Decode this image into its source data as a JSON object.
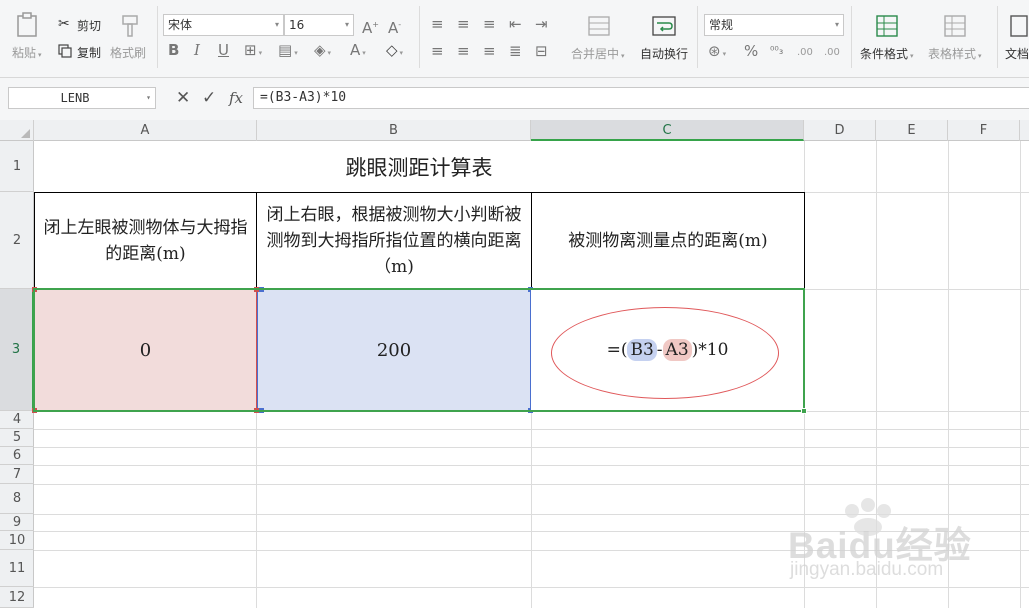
{
  "ribbon": {
    "paste_label": "粘贴",
    "cut_label": "剪切",
    "copy_label": "复制",
    "format_painter_label": "格式刷",
    "font_name": "宋体",
    "font_size": "16",
    "merge_center_label": "合并居中",
    "wrap_text_label": "自动换行",
    "number_format": "常规",
    "conditional_format_label": "条件格式",
    "table_style_label": "表格样式",
    "doc_label": "文档",
    "increase_decimal": ".00",
    "decrease_decimal": ".00"
  },
  "formula_bar": {
    "name_box": "LENB",
    "fx_label": "fx",
    "formula": "=(B3-A3)*10"
  },
  "columns": [
    "A",
    "B",
    "C",
    "D",
    "E",
    "F"
  ],
  "rows": [
    "1",
    "2",
    "3",
    "4",
    "5",
    "6",
    "7",
    "8",
    "9",
    "10",
    "11",
    "12"
  ],
  "sheet": {
    "title": "跳眼测距计算表",
    "header_a": "闭上左眼被测物体与大拇指的距离(m)",
    "header_b": "闭上右眼，根据被测物大小判断被测物到大拇指所指位置的横向距离（m)",
    "header_c": "被测物离测量点的距离(m)",
    "a3_value": "0",
    "b3_value": "200",
    "c3_formula": {
      "prefix": "=(",
      "ref1": "B3",
      "op": "-",
      "ref2": "A3",
      "suffix": ")*10"
    }
  },
  "colors": {
    "selection": "#3fa34d",
    "ref_b3": "#4a6fcf",
    "ref_a3": "#d05050",
    "annotation_ellipse": "#e0585a"
  },
  "watermark": {
    "brand": "Baidu经验",
    "url": "jingyan.baidu.com"
  }
}
